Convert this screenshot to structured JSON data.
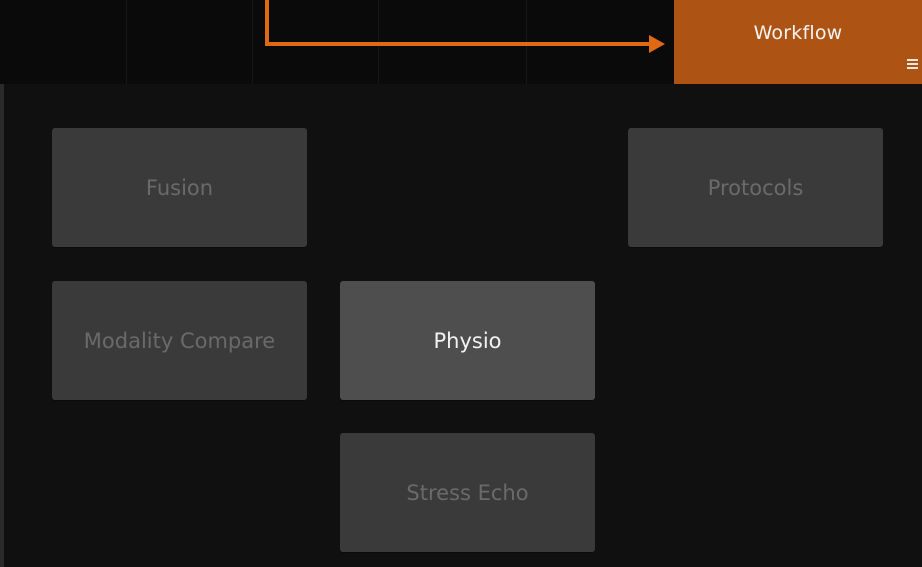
{
  "header": {
    "workflow_tab_label": "Workflow",
    "menu_icon": "hamburger-menu-icon",
    "accent_color": "#ad5414",
    "arrow_color": "#e06a14"
  },
  "tiles": {
    "fusion": "Fusion",
    "protocols": "Protocols",
    "modality_compare": "Modality Compare",
    "physio": "Physio",
    "stress_echo": "Stress Echo"
  },
  "state": {
    "active_tile": "Physio"
  }
}
